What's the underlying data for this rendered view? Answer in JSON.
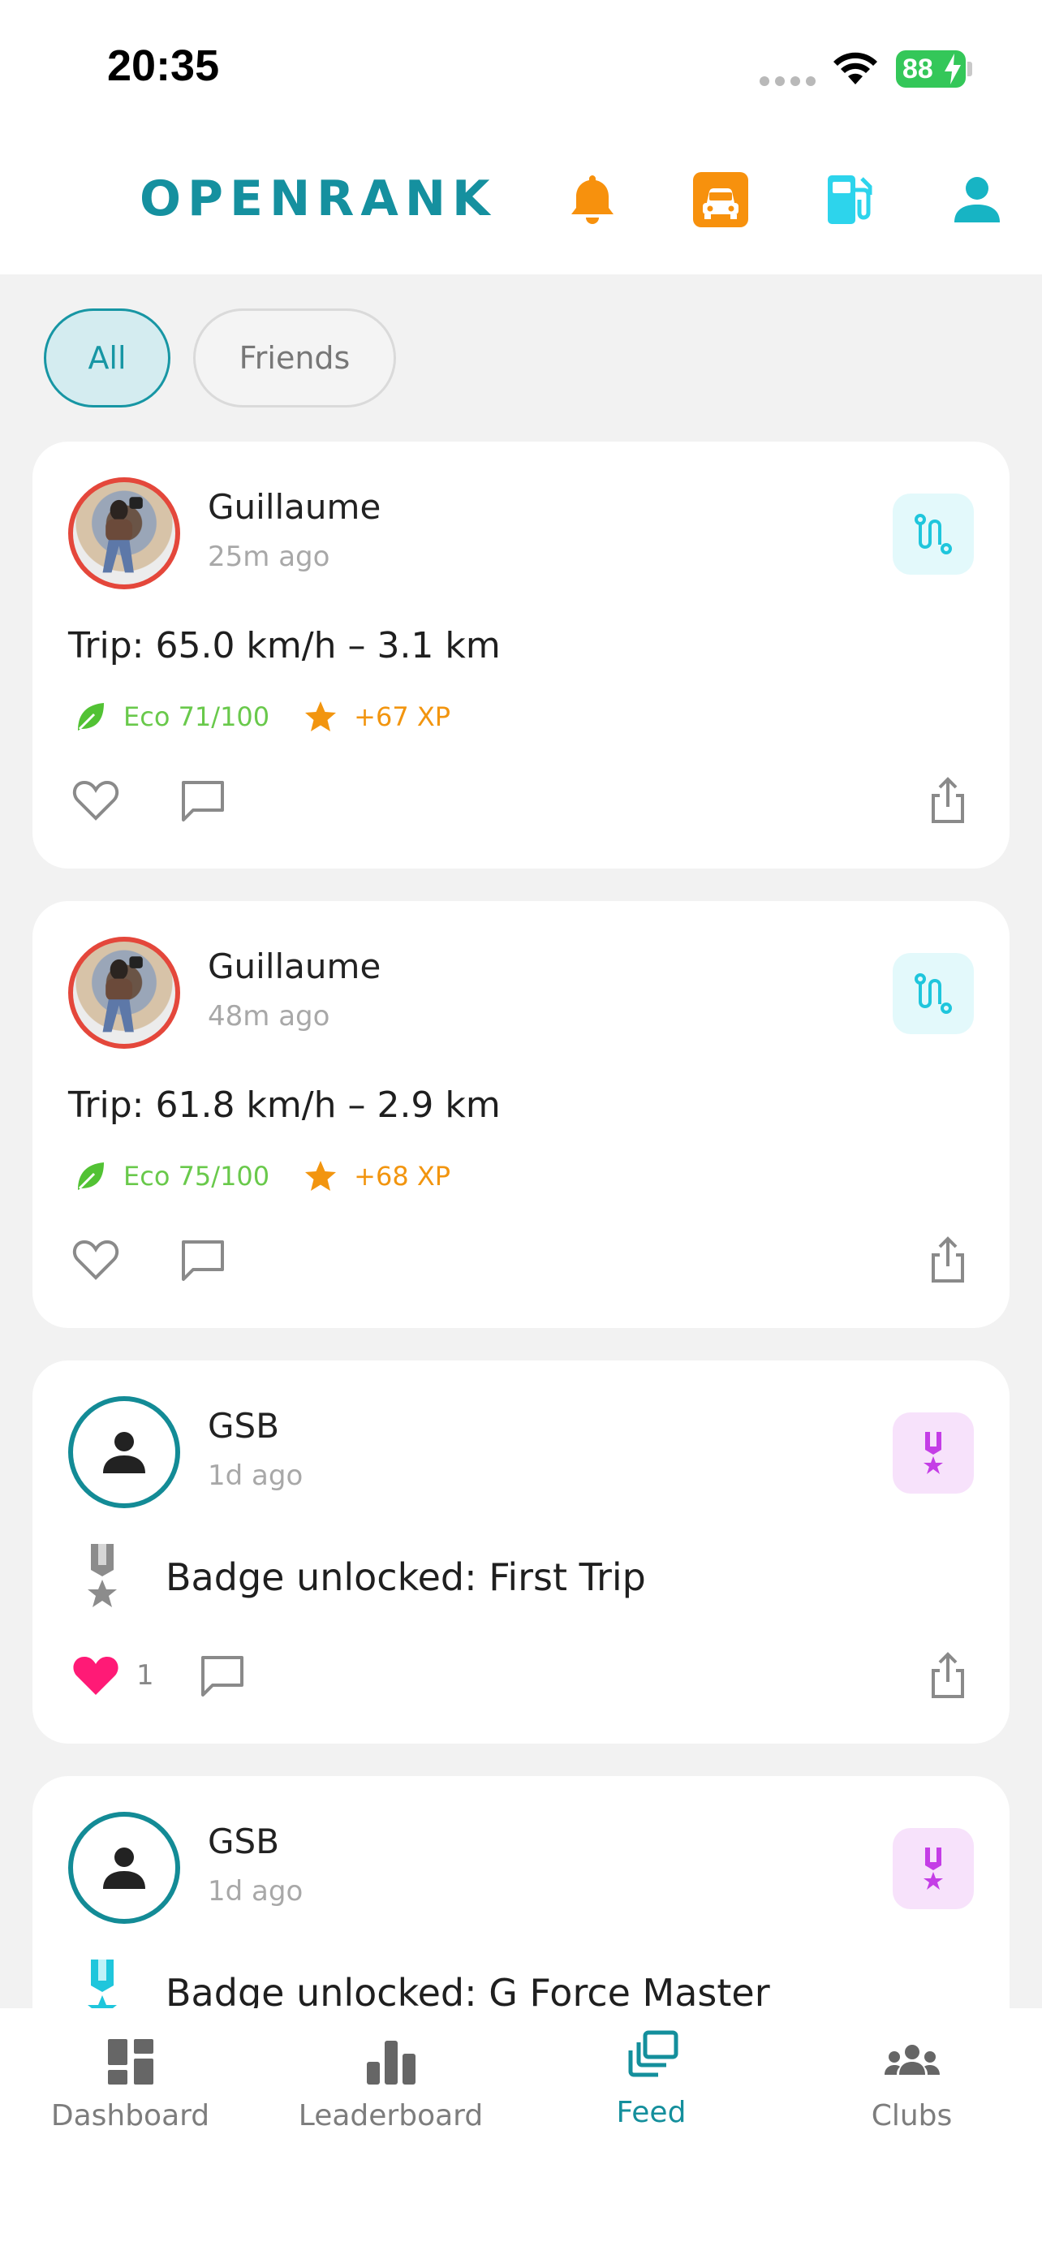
{
  "status_bar": {
    "time": "20:35",
    "battery": "88"
  },
  "header": {
    "brand": "OPENRANK",
    "icons": [
      "bell-icon",
      "car-icon",
      "fuel-pump-icon",
      "profile-icon"
    ],
    "colors": {
      "brand": "#15909f",
      "bell": "#f7910d",
      "car": "#f7910d",
      "fuel": "#2dd4ec",
      "profile": "#17b4c4"
    }
  },
  "filters": {
    "all": "All",
    "friends": "Friends",
    "selected": "All"
  },
  "feed": [
    {
      "user": "Guillaume",
      "ago": "25m ago",
      "kind": "trip",
      "type_icon": "route-icon",
      "title": "Trip: 65.0 km/h – 3.1 km",
      "eco": "Eco 71/100",
      "xp": "+67 XP",
      "likes": "",
      "liked": false
    },
    {
      "user": "Guillaume",
      "ago": "48m ago",
      "kind": "trip",
      "type_icon": "route-icon",
      "title": "Trip: 61.8 km/h – 2.9 km",
      "eco": "Eco 75/100",
      "xp": "+68 XP",
      "likes": "",
      "liked": false
    },
    {
      "user": "GSB",
      "ago": "1d ago",
      "kind": "badge",
      "type_icon": "medal-icon",
      "title": "Badge unlocked: First Trip",
      "likes": "1",
      "liked": true
    },
    {
      "user": "GSB",
      "ago": "1d ago",
      "kind": "badge",
      "type_icon": "medal-icon",
      "title": "Badge unlocked: G Force Master",
      "likes": "",
      "liked": false
    }
  ],
  "bottom_nav": {
    "items": [
      {
        "label": "Dashboard",
        "icon": "dashboard-icon"
      },
      {
        "label": "Leaderboard",
        "icon": "leaderboard-icon"
      },
      {
        "label": "Feed",
        "icon": "feed-icon"
      },
      {
        "label": "Clubs",
        "icon": "clubs-icon"
      }
    ],
    "active": "Feed"
  },
  "colors": {
    "accent": "#148f9c",
    "eco": "#69c94b",
    "xp": "#f2950f",
    "like": "#ff1a76",
    "medal": "#c43ee6"
  }
}
